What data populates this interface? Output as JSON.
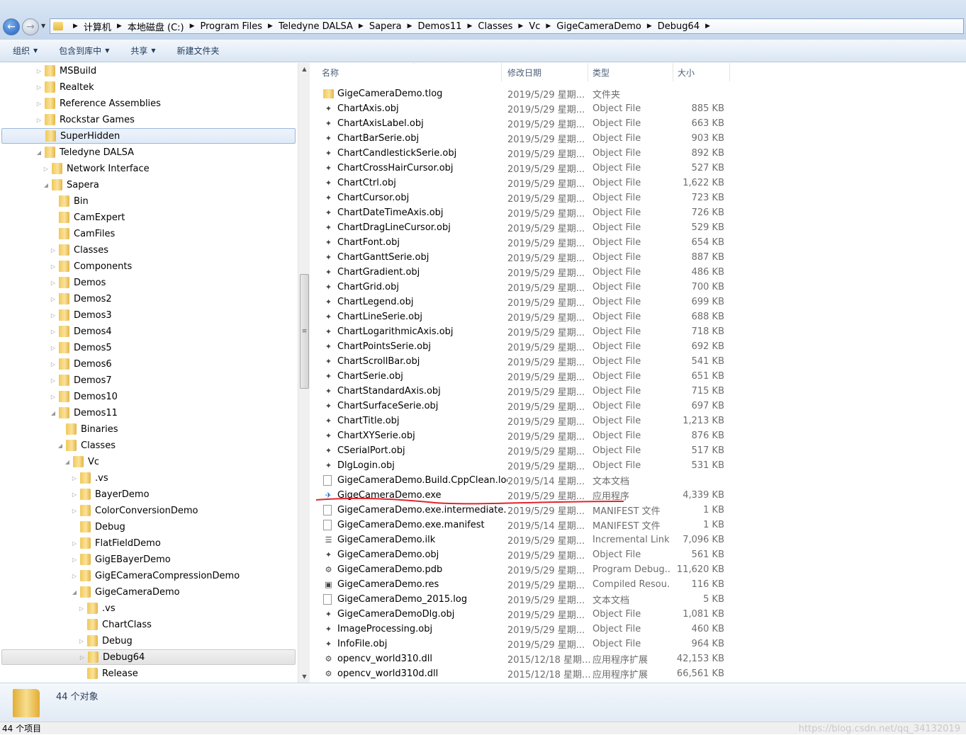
{
  "breadcrumb": [
    "计算机",
    "本地磁盘 (C:)",
    "Program Files",
    "Teledyne DALSA",
    "Sapera",
    "Demos11",
    "Classes",
    "Vc",
    "GigeCameraDemo",
    "Debug64"
  ],
  "toolbar": {
    "organize": "组织",
    "include_library": "包含到库中",
    "share": "共享",
    "new_folder": "新建文件夹"
  },
  "tree": [
    {
      "label": "MSBuild",
      "level": 0,
      "arrow": "closed"
    },
    {
      "label": "Realtek",
      "level": 0,
      "arrow": "closed"
    },
    {
      "label": "Reference Assemblies",
      "level": 0,
      "arrow": "closed"
    },
    {
      "label": "Rockstar Games",
      "level": 0,
      "arrow": "closed"
    },
    {
      "label": "SuperHidden",
      "level": 0,
      "arrow": "none",
      "state": "selected"
    },
    {
      "label": "Teledyne DALSA",
      "level": 0,
      "arrow": "open"
    },
    {
      "label": "Network Interface",
      "level": 1,
      "arrow": "closed"
    },
    {
      "label": "Sapera",
      "level": 1,
      "arrow": "open"
    },
    {
      "label": "Bin",
      "level": 2,
      "arrow": "none"
    },
    {
      "label": "CamExpert",
      "level": 2,
      "arrow": "none"
    },
    {
      "label": "CamFiles",
      "level": 2,
      "arrow": "none"
    },
    {
      "label": "Classes",
      "level": 2,
      "arrow": "closed"
    },
    {
      "label": "Components",
      "level": 2,
      "arrow": "closed"
    },
    {
      "label": "Demos",
      "level": 2,
      "arrow": "closed"
    },
    {
      "label": "Demos2",
      "level": 2,
      "arrow": "closed"
    },
    {
      "label": "Demos3",
      "level": 2,
      "arrow": "closed"
    },
    {
      "label": "Demos4",
      "level": 2,
      "arrow": "closed"
    },
    {
      "label": "Demos5",
      "level": 2,
      "arrow": "closed"
    },
    {
      "label": "Demos6",
      "level": 2,
      "arrow": "closed"
    },
    {
      "label": "Demos7",
      "level": 2,
      "arrow": "closed"
    },
    {
      "label": "Demos10",
      "level": 2,
      "arrow": "closed"
    },
    {
      "label": "Demos11",
      "level": 2,
      "arrow": "open"
    },
    {
      "label": "Binaries",
      "level": 3,
      "arrow": "none"
    },
    {
      "label": "Classes",
      "level": 3,
      "arrow": "open"
    },
    {
      "label": "Vc",
      "level": 4,
      "arrow": "open"
    },
    {
      "label": ".vs",
      "level": 5,
      "arrow": "closed"
    },
    {
      "label": "BayerDemo",
      "level": 5,
      "arrow": "closed"
    },
    {
      "label": "ColorConversionDemo",
      "level": 5,
      "arrow": "closed"
    },
    {
      "label": "Debug",
      "level": 5,
      "arrow": "none"
    },
    {
      "label": "FlatFieldDemo",
      "level": 5,
      "arrow": "closed"
    },
    {
      "label": "GigEBayerDemo",
      "level": 5,
      "arrow": "closed"
    },
    {
      "label": "GigECameraCompressionDemo",
      "level": 5,
      "arrow": "closed"
    },
    {
      "label": "GigeCameraDemo",
      "level": 5,
      "arrow": "open"
    },
    {
      "label": ".vs",
      "level": 6,
      "arrow": "closed"
    },
    {
      "label": "ChartClass",
      "level": 6,
      "arrow": "none"
    },
    {
      "label": "Debug",
      "level": 6,
      "arrow": "closed"
    },
    {
      "label": "Debug64",
      "level": 6,
      "arrow": "closed",
      "state": "current"
    },
    {
      "label": "Release",
      "level": 6,
      "arrow": "none"
    }
  ],
  "columns": {
    "name": "名称",
    "date": "修改日期",
    "type": "类型",
    "size": "大小"
  },
  "files": [
    {
      "name": "GigeCameraDemo.tlog",
      "date": "2019/5/29 星期...",
      "type": "文件夹",
      "size": "",
      "icon": "folder-icon"
    },
    {
      "name": "ChartAxis.obj",
      "date": "2019/5/29 星期...",
      "type": "Object File",
      "size": "885 KB",
      "icon": "obj-file-icon"
    },
    {
      "name": "ChartAxisLabel.obj",
      "date": "2019/5/29 星期...",
      "type": "Object File",
      "size": "663 KB",
      "icon": "obj-file-icon"
    },
    {
      "name": "ChartBarSerie.obj",
      "date": "2019/5/29 星期...",
      "type": "Object File",
      "size": "903 KB",
      "icon": "obj-file-icon"
    },
    {
      "name": "ChartCandlestickSerie.obj",
      "date": "2019/5/29 星期...",
      "type": "Object File",
      "size": "892 KB",
      "icon": "obj-file-icon"
    },
    {
      "name": "ChartCrossHairCursor.obj",
      "date": "2019/5/29 星期...",
      "type": "Object File",
      "size": "527 KB",
      "icon": "obj-file-icon"
    },
    {
      "name": "ChartCtrl.obj",
      "date": "2019/5/29 星期...",
      "type": "Object File",
      "size": "1,622 KB",
      "icon": "obj-file-icon"
    },
    {
      "name": "ChartCursor.obj",
      "date": "2019/5/29 星期...",
      "type": "Object File",
      "size": "723 KB",
      "icon": "obj-file-icon"
    },
    {
      "name": "ChartDateTimeAxis.obj",
      "date": "2019/5/29 星期...",
      "type": "Object File",
      "size": "726 KB",
      "icon": "obj-file-icon"
    },
    {
      "name": "ChartDragLineCursor.obj",
      "date": "2019/5/29 星期...",
      "type": "Object File",
      "size": "529 KB",
      "icon": "obj-file-icon"
    },
    {
      "name": "ChartFont.obj",
      "date": "2019/5/29 星期...",
      "type": "Object File",
      "size": "654 KB",
      "icon": "obj-file-icon"
    },
    {
      "name": "ChartGanttSerie.obj",
      "date": "2019/5/29 星期...",
      "type": "Object File",
      "size": "887 KB",
      "icon": "obj-file-icon"
    },
    {
      "name": "ChartGradient.obj",
      "date": "2019/5/29 星期...",
      "type": "Object File",
      "size": "486 KB",
      "icon": "obj-file-icon"
    },
    {
      "name": "ChartGrid.obj",
      "date": "2019/5/29 星期...",
      "type": "Object File",
      "size": "700 KB",
      "icon": "obj-file-icon"
    },
    {
      "name": "ChartLegend.obj",
      "date": "2019/5/29 星期...",
      "type": "Object File",
      "size": "699 KB",
      "icon": "obj-file-icon"
    },
    {
      "name": "ChartLineSerie.obj",
      "date": "2019/5/29 星期...",
      "type": "Object File",
      "size": "688 KB",
      "icon": "obj-file-icon"
    },
    {
      "name": "ChartLogarithmicAxis.obj",
      "date": "2019/5/29 星期...",
      "type": "Object File",
      "size": "718 KB",
      "icon": "obj-file-icon"
    },
    {
      "name": "ChartPointsSerie.obj",
      "date": "2019/5/29 星期...",
      "type": "Object File",
      "size": "692 KB",
      "icon": "obj-file-icon"
    },
    {
      "name": "ChartScrollBar.obj",
      "date": "2019/5/29 星期...",
      "type": "Object File",
      "size": "541 KB",
      "icon": "obj-file-icon"
    },
    {
      "name": "ChartSerie.obj",
      "date": "2019/5/29 星期...",
      "type": "Object File",
      "size": "651 KB",
      "icon": "obj-file-icon"
    },
    {
      "name": "ChartStandardAxis.obj",
      "date": "2019/5/29 星期...",
      "type": "Object File",
      "size": "715 KB",
      "icon": "obj-file-icon"
    },
    {
      "name": "ChartSurfaceSerie.obj",
      "date": "2019/5/29 星期...",
      "type": "Object File",
      "size": "697 KB",
      "icon": "obj-file-icon"
    },
    {
      "name": "ChartTitle.obj",
      "date": "2019/5/29 星期...",
      "type": "Object File",
      "size": "1,213 KB",
      "icon": "obj-file-icon"
    },
    {
      "name": "ChartXYSerie.obj",
      "date": "2019/5/29 星期...",
      "type": "Object File",
      "size": "876 KB",
      "icon": "obj-file-icon"
    },
    {
      "name": "CSerialPort.obj",
      "date": "2019/5/29 星期...",
      "type": "Object File",
      "size": "517 KB",
      "icon": "obj-file-icon"
    },
    {
      "name": "DlgLogin.obj",
      "date": "2019/5/29 星期...",
      "type": "Object File",
      "size": "531 KB",
      "icon": "obj-file-icon"
    },
    {
      "name": "GigeCameraDemo.Build.CppClean.log",
      "date": "2019/5/14 星期...",
      "type": "文本文档",
      "size": "",
      "icon": "text-file-icon"
    },
    {
      "name": "GigeCameraDemo.exe",
      "date": "2019/5/29 星期...",
      "type": "应用程序",
      "size": "4,339 KB",
      "icon": "exe-icon"
    },
    {
      "name": "GigeCameraDemo.exe.intermediate....",
      "date": "2019/5/29 星期...",
      "type": "MANIFEST 文件",
      "size": "1 KB",
      "icon": "blank-file-icon"
    },
    {
      "name": "GigeCameraDemo.exe.manifest",
      "date": "2019/5/14 星期...",
      "type": "MANIFEST 文件",
      "size": "1 KB",
      "icon": "blank-file-icon"
    },
    {
      "name": "GigeCameraDemo.ilk",
      "date": "2019/5/29 星期...",
      "type": "Incremental Link...",
      "size": "7,096 KB",
      "icon": "ilk-file-icon"
    },
    {
      "name": "GigeCameraDemo.obj",
      "date": "2019/5/29 星期...",
      "type": "Object File",
      "size": "561 KB",
      "icon": "obj-file-icon"
    },
    {
      "name": "GigeCameraDemo.pdb",
      "date": "2019/5/29 星期...",
      "type": "Program Debug...",
      "size": "11,620 KB",
      "icon": "pdb-file-icon"
    },
    {
      "name": "GigeCameraDemo.res",
      "date": "2019/5/29 星期...",
      "type": "Compiled Resou...",
      "size": "116 KB",
      "icon": "res-file-icon"
    },
    {
      "name": "GigeCameraDemo_2015.log",
      "date": "2019/5/29 星期...",
      "type": "文本文档",
      "size": "5 KB",
      "icon": "text-file-icon"
    },
    {
      "name": "GigeCameraDemoDlg.obj",
      "date": "2019/5/29 星期...",
      "type": "Object File",
      "size": "1,081 KB",
      "icon": "obj-file-icon"
    },
    {
      "name": "ImageProcessing.obj",
      "date": "2019/5/29 星期...",
      "type": "Object File",
      "size": "460 KB",
      "icon": "obj-file-icon"
    },
    {
      "name": "InfoFile.obj",
      "date": "2019/5/29 星期...",
      "type": "Object File",
      "size": "964 KB",
      "icon": "obj-file-icon"
    },
    {
      "name": "opencv_world310.dll",
      "date": "2015/12/18 星期...",
      "type": "应用程序扩展",
      "size": "42,153 KB",
      "icon": "dll-file-icon"
    },
    {
      "name": "opencv_world310d.dll",
      "date": "2015/12/18 星期...",
      "type": "应用程序扩展",
      "size": "66,561 KB",
      "icon": "dll-file-icon"
    }
  ],
  "details": {
    "count": "44 个对象"
  },
  "status": {
    "items": "44 个项目",
    "watermark": "https://blog.csdn.net/qq_34132019"
  },
  "colors": {
    "selection_border": "#9bb7dd",
    "underline": "#e0252b",
    "folder": "#f0c85a"
  }
}
